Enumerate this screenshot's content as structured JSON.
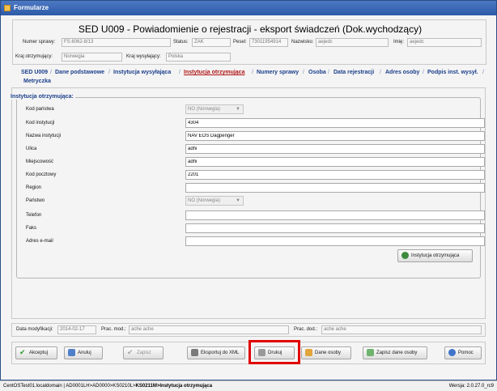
{
  "window": {
    "title": "Formularze"
  },
  "header": {
    "title": "SED U009 - Powiadomienie o rejestracji - eksport świadczeń (Dok.wychodzący)",
    "numer_sprawy_label": "Numer sprawy:",
    "numer_sprawy_value": "FS.6062-8/13",
    "status_label": "Status:",
    "status_value": "ZAK",
    "pesel_label": "Pesel:",
    "pesel_value": "73011954914",
    "nazwisko_label": "Nazwisko:",
    "nazwisko_value": "aejedc",
    "imie_label": "Imię:",
    "imie_value": "aejedc",
    "kraj_otrzymujacy_label": "Kraj otrzymujący:",
    "kraj_otrzymujacy_value": "Norwegia",
    "kraj_wysylajacy_label": "Kraj wysyłający:",
    "kraj_wysylajacy_value": "Polska"
  },
  "tabs": [
    {
      "label": "SED U009"
    },
    {
      "label": "Dane podstawowe"
    },
    {
      "label": "Instytucja wysyłająca"
    },
    {
      "label": "Instytucja otrzymująca",
      "active": true
    },
    {
      "label": "Numery sprawy"
    },
    {
      "label": "Osoba"
    },
    {
      "label": "Data rejestracji"
    },
    {
      "label": "Adres osoby"
    },
    {
      "label": "Podpis inst. wysył."
    },
    {
      "label": "Metryczka"
    }
  ],
  "group": {
    "title": "Instytucja otrzymująca:",
    "fields": [
      {
        "label": "Kod państwa",
        "type": "select",
        "value": "NO (Norwegia)"
      },
      {
        "label": "Kod instytucji",
        "type": "input",
        "value": "4304"
      },
      {
        "label": "Nazwa instytucji",
        "type": "input",
        "value": "NAV EOS Dagpenger"
      },
      {
        "label": "Ulica",
        "type": "input",
        "value": "adhi"
      },
      {
        "label": "Miejscowość",
        "type": "input",
        "value": "adhi"
      },
      {
        "label": "Kod pocztowy",
        "type": "input",
        "value": "2201"
      },
      {
        "label": "Region",
        "type": "input",
        "value": ""
      },
      {
        "label": "Państwo",
        "type": "select",
        "value": "NO (Norwegia)"
      },
      {
        "label": "Telefon",
        "type": "input",
        "value": ""
      },
      {
        "label": "Faks",
        "type": "input",
        "value": ""
      },
      {
        "label": "Adres e-mail",
        "type": "input",
        "value": ""
      }
    ],
    "lookup_button": "Instytucja otrzymująca"
  },
  "modbar": {
    "data_modyfikacji_label": "Data modyfikacji:",
    "data_modyfikacji_value": "2014-02-17",
    "prac_mod_label": "Prac. mod.:",
    "prac_mod_value": "ache ache",
    "prac_dod_label": "Prac. dod.:",
    "prac_dod_value": "ache ache"
  },
  "actions": {
    "akceptuj": "Akceptuj",
    "anuluj": "Anuluj",
    "zapisz": "Zapisz",
    "eksportuj": "Eksportuj do XML",
    "drukuj": "Drukuj",
    "dane_osoby": "Dane osoby",
    "zapisz_dane_osoby": "Zapisz dane osoby",
    "pomoc": "Pomoc"
  },
  "status": {
    "path_prefix": "CentOSTest01.localdomain | AD0001LH>AD0000>KS0210L>",
    "path_current": "KS0211M>Instytucja otrzymująca",
    "version": "Wersja: 2.0.27.0_rc9"
  },
  "colors": {
    "accent_blue": "#1b3f8b",
    "active_tab": "#b01515",
    "highlight": "#e00000"
  }
}
